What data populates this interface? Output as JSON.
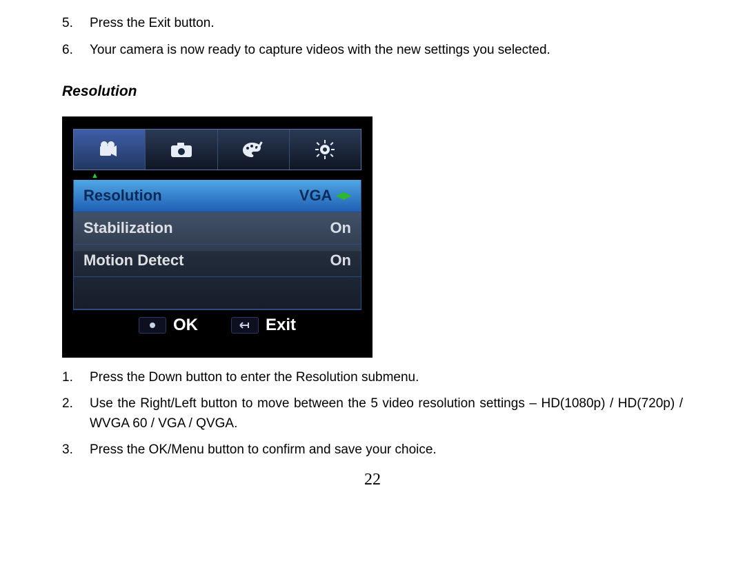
{
  "steps_top": [
    {
      "n": "5.",
      "text": "Press the Exit button."
    },
    {
      "n": "6.",
      "text": "Your camera is now ready to capture videos with the new settings you selected."
    }
  ],
  "section_heading": "Resolution",
  "camera_menu": {
    "tabs": [
      {
        "icon": "video-icon",
        "active": true
      },
      {
        "icon": "camera-icon",
        "active": false
      },
      {
        "icon": "palette-icon",
        "active": false
      },
      {
        "icon": "gear-icon",
        "active": false
      }
    ],
    "rows": [
      {
        "label": "Resolution",
        "value": "VGA",
        "selected": true,
        "arrows": true
      },
      {
        "label": "Stabilization",
        "value": "On",
        "selected": false,
        "arrows": false
      },
      {
        "label": "Motion Detect",
        "value": "On",
        "selected": false,
        "arrows": false
      }
    ],
    "footer": {
      "ok_label": "OK",
      "exit_label": "Exit"
    }
  },
  "steps_bottom": [
    {
      "n": "1.",
      "text": "Press the Down button to enter the Resolution submenu."
    },
    {
      "n": "2.",
      "text": "Use the Right/Left button to move between the 5 video resolution settings – HD(1080p) / HD(720p) / WVGA 60 / VGA / QVGA.",
      "justify": true
    },
    {
      "n": "3.",
      "text": "Press the OK/Menu button to confirm and save your choice."
    }
  ],
  "page_number": "22"
}
